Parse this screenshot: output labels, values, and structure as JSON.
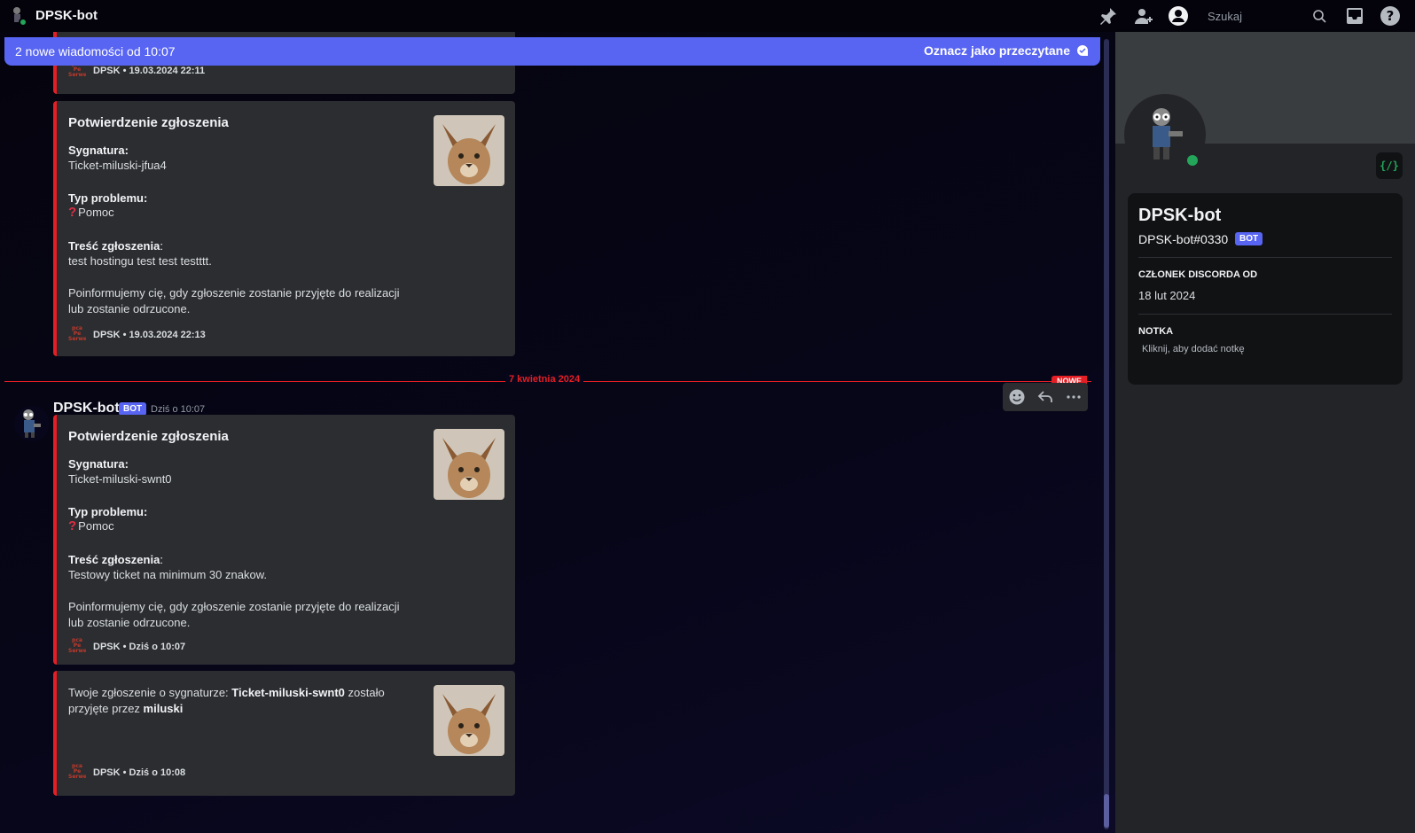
{
  "topbar": {
    "title": "DPSK-bot",
    "search_placeholder": "Szukaj"
  },
  "new_messages_bar": {
    "text": "2 nowe wiadomości od 10:07",
    "mark_read_label": "Oznacz jako przeczytane"
  },
  "previous_embed_footer": {
    "author": "DPSK",
    "time": "19.03.2024 22:11"
  },
  "embed1": {
    "title": "Potwierdzenie zgłoszenia",
    "field1_name": "Sygnatura:",
    "field1_value": "Ticket-miluski-jfua4",
    "field2_name": "Typ problemu:",
    "field2_value": "Pomoc",
    "field3_name": "Treść zgłoszenia",
    "field3_colon": ":",
    "field3_value": "test hostingu test test testttt.",
    "note_line1": "Poinformujemy cię, gdy zgłoszenie zostanie przyjęte do realizacji",
    "note_line2": "lub zostanie odrzucone.",
    "footer_author": "DPSK",
    "footer_time": "19.03.2024 22:13"
  },
  "divider": {
    "date": "7 kwietnia 2024",
    "new_label": "NOWE"
  },
  "message": {
    "author": "DPSK-bot",
    "bot_tag": "BOT",
    "timestamp": "Dziś o 10:07"
  },
  "embed2": {
    "title": "Potwierdzenie zgłoszenia",
    "field1_name": "Sygnatura:",
    "field1_value": "Ticket-miluski-swnt0",
    "field2_name": "Typ problemu:",
    "field2_value": "Pomoc",
    "field3_name": "Treść zgłoszenia",
    "field3_colon": ":",
    "field3_value": "Testowy ticket na minimum 30 znakow.",
    "note_line1": "Poinformujemy cię, gdy zgłoszenie zostanie przyjęte do realizacji",
    "note_line2": "lub zostanie odrzucone.",
    "footer_author": "DPSK",
    "footer_time": "Dziś o 10:07"
  },
  "embed3": {
    "text_prefix": "Twoje zgłoszenie o sygnaturze: ",
    "ticket": "Ticket-miluski-swnt0",
    "text_mid": " zostało",
    "text_line2_prefix": "przyjęte przez ",
    "accepted_by": "miluski",
    "footer_author": "DPSK",
    "footer_time": "Dziś o 10:08"
  },
  "footer_icon_text": "pca Pe Serwe",
  "profile": {
    "name": "DPSK-bot",
    "tag": "DPSK-bot#0330",
    "bot_tag": "BOT",
    "member_since_heading": "CZŁONEK DISCORDA OD",
    "member_since": "18 lut 2024",
    "note_heading": "NOTKA",
    "note_placeholder": "Kliknij, aby dodać notkę",
    "dev_badge": "{/}"
  },
  "colors": {
    "accent": "#5865f2",
    "embed_border": "#e31e24",
    "online": "#23a55a"
  }
}
